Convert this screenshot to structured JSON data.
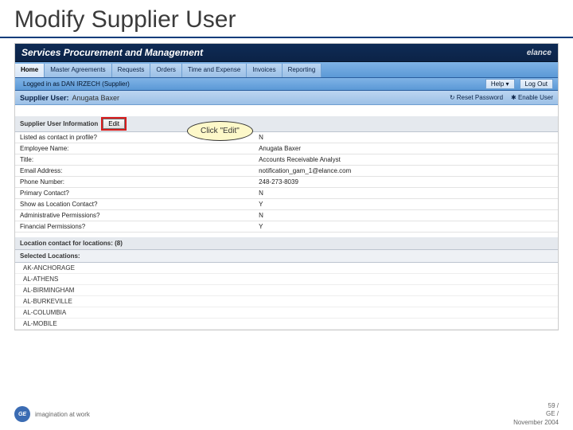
{
  "slide": {
    "title": "Modify Supplier User"
  },
  "titlebar": {
    "title": "Services Procurement and Management",
    "brand": "elance"
  },
  "tabs": [
    {
      "label": "Home"
    },
    {
      "label": "Master Agreements"
    },
    {
      "label": "Requests"
    },
    {
      "label": "Orders"
    },
    {
      "label": "Time and Expense"
    },
    {
      "label": "Invoices"
    },
    {
      "label": "Reporting"
    }
  ],
  "util": {
    "status": "Logged in as DAN IRZECH (Supplier)",
    "help": "Help ▾",
    "logout": "Log Out"
  },
  "pageheader": {
    "label": "Supplier User:",
    "value": "Anugata Baxer",
    "reset": "Reset Password",
    "extra": "Enable User"
  },
  "callout": "Click \"Edit\"",
  "info_section_title": "Supplier User Information",
  "edit_label": "Edit",
  "rows": [
    {
      "l": "Listed as contact in profile?",
      "v": "N"
    },
    {
      "l": "Employee Name:",
      "v": "Anugata Baxer"
    },
    {
      "l": "Title:",
      "v": "Accounts Receivable Analyst"
    },
    {
      "l": "Email Address:",
      "v": "notification_gam_1@elance.com"
    },
    {
      "l": "Phone Number:",
      "v": "248-273-8039"
    },
    {
      "l": "Primary Contact?",
      "v": "N"
    },
    {
      "l": "Show as Location Contact?",
      "v": "Y"
    },
    {
      "l": "Administrative Permissions?",
      "v": "N"
    },
    {
      "l": "Financial Permissions?",
      "v": "Y"
    }
  ],
  "loc_header": "Location contact for locations: (8)",
  "selected_header": "Selected Locations:",
  "locations": [
    "AK-ANCHORAGE",
    "AL-ATHENS",
    "AL-BIRMINGHAM",
    "AL-BURKEVILLE",
    "AL-COLUMBIA",
    "AL-MOBILE"
  ],
  "footer": {
    "tagline": "imagination at work",
    "page": "59 /",
    "org": "GE /",
    "date": "November 2004"
  }
}
